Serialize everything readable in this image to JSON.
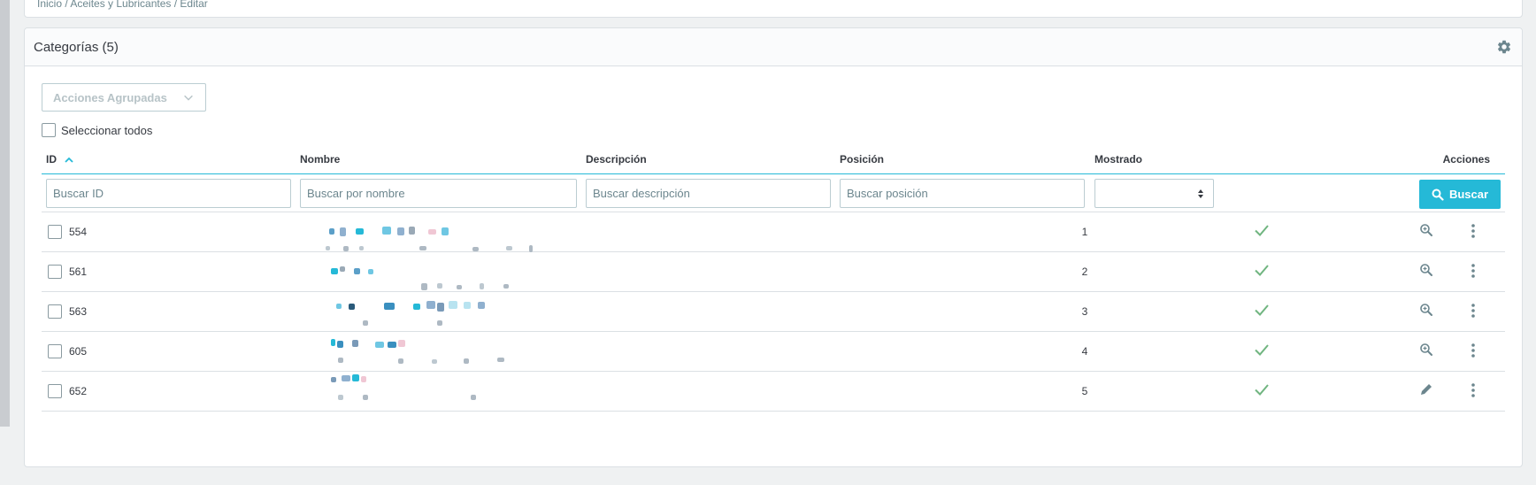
{
  "breadcrumb": "Inicio / Aceites y Lubricantes / Editar",
  "panel": {
    "title": "Categorías (5)"
  },
  "bulk_actions": {
    "label": "Acciones Agrupadas"
  },
  "select_all": {
    "label": "Seleccionar todos"
  },
  "columns": {
    "id": "ID",
    "name": "Nombre",
    "description": "Descripción",
    "position": "Posición",
    "shown": "Mostrado",
    "actions": "Acciones"
  },
  "filters": {
    "id_placeholder": "Buscar ID",
    "name_placeholder": "Buscar por nombre",
    "description_placeholder": "Buscar descripción",
    "position_placeholder": "Buscar posición",
    "search_button": "Buscar"
  },
  "rows": [
    {
      "id": "554",
      "position": "1",
      "shown": true,
      "action_icon": "zoom-icon"
    },
    {
      "id": "561",
      "position": "2",
      "shown": true,
      "action_icon": "zoom-icon"
    },
    {
      "id": "563",
      "position": "3",
      "shown": true,
      "action_icon": "zoom-icon"
    },
    {
      "id": "605",
      "position": "4",
      "shown": true,
      "action_icon": "zoom-icon"
    },
    {
      "id": "652",
      "position": "5",
      "shown": true,
      "action_icon": "edit-pencil-icon"
    }
  ],
  "colors": {
    "accent": "#25b9d7",
    "success": "#70b580",
    "text": "#363a41",
    "muted": "#6c868e"
  }
}
